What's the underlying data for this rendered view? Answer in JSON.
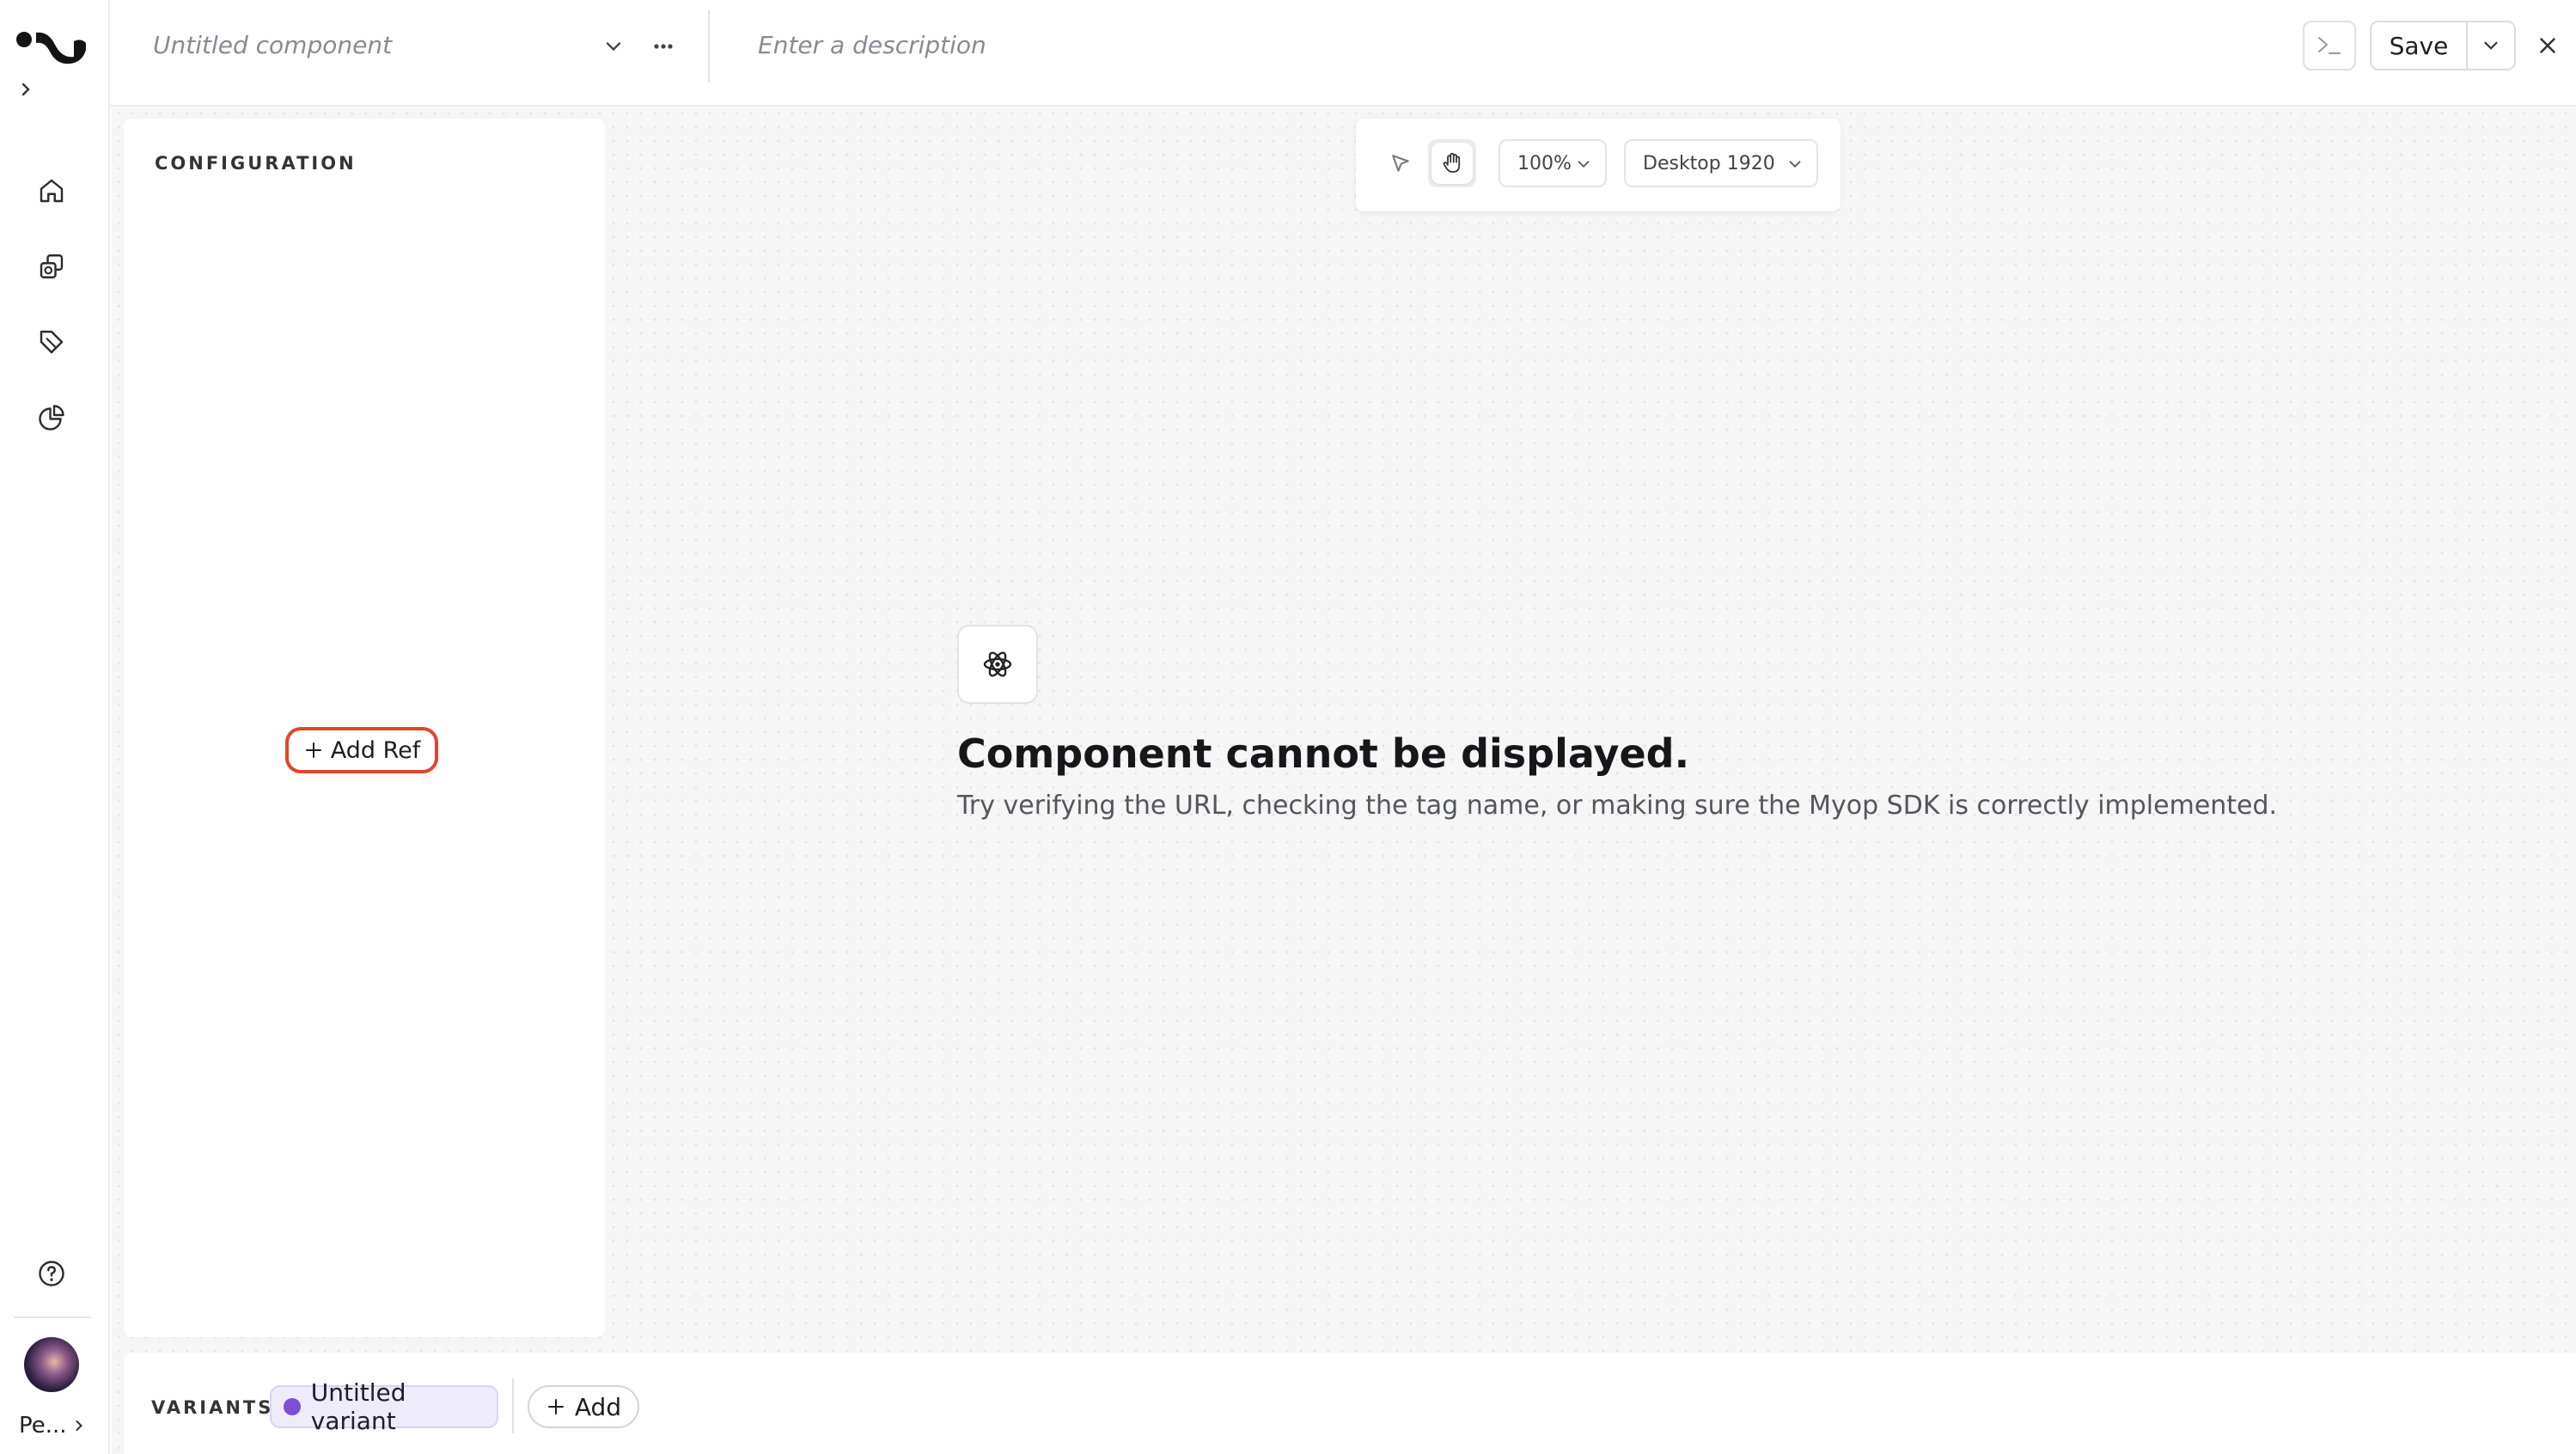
{
  "header": {
    "component_name_placeholder": "Untitled component",
    "description_placeholder": "Enter a description",
    "save_label": "Save"
  },
  "sidebar": {
    "items": [
      {
        "name": "home",
        "icon": "home-icon"
      },
      {
        "name": "components",
        "icon": "components-icon"
      },
      {
        "name": "tags",
        "icon": "tag-icon"
      },
      {
        "name": "analytics",
        "icon": "pie-chart-icon"
      }
    ],
    "help_icon": "help-icon",
    "user_label": "Pe..."
  },
  "configuration": {
    "title": "CONFIGURATION",
    "add_ref_label": "Add Ref"
  },
  "canvas_toolbar": {
    "zoom": "100%",
    "device": "Desktop 1920"
  },
  "preview": {
    "error_title": "Component cannot be displayed.",
    "error_message": "Try verifying the URL, checking the tag name, or making sure the Myop SDK is correctly implemented."
  },
  "variants": {
    "label": "VARIANTS",
    "items": [
      {
        "label": "Untitled variant",
        "color": "#7c4fd6"
      }
    ],
    "add_label": "Add"
  },
  "colors": {
    "accent_highlight": "#e2452d",
    "variant_dot": "#7c4fd6"
  }
}
